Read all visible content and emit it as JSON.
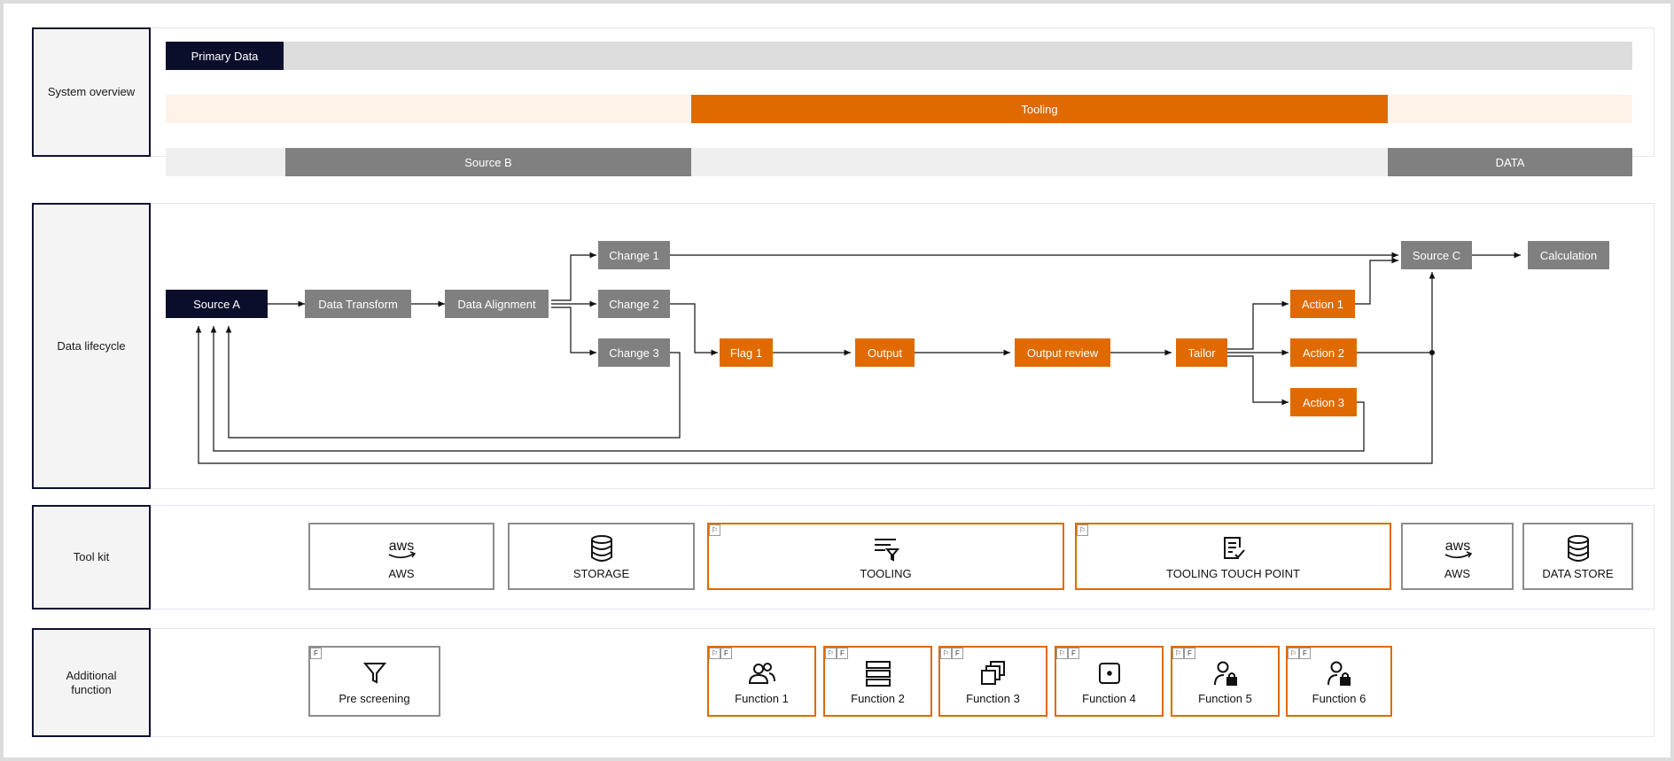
{
  "rows": {
    "system_overview": "System overview",
    "data_lifecycle": "Data lifecycle",
    "tool_kit": "Tool kit",
    "additional_function_line1": "Additional",
    "additional_function_line2": "function"
  },
  "overview": {
    "primary_data": "Primary Data",
    "tooling": "Tooling",
    "source_b": "Source B",
    "data": "DATA"
  },
  "lifecycle": {
    "source_a": "Source A",
    "data_transform": "Data Transform",
    "data_alignment": "Data Alignment",
    "change_1": "Change 1",
    "change_2": "Change 2",
    "change_3": "Change 3",
    "flag_1": "Flag 1",
    "output": "Output",
    "output_review": "Output review",
    "tailor": "Tailor",
    "action_1": "Action 1",
    "action_2": "Action 2",
    "action_3": "Action 3",
    "source_c": "Source C",
    "calculation": "Calculation"
  },
  "toolkit": {
    "aws_1": "AWS",
    "storage": "STORAGE",
    "tooling": "TOOLING",
    "tooling_touch_point": "TOOLING TOUCH POINT",
    "aws_2": "AWS",
    "data_store": "DATA STORE"
  },
  "functions": {
    "pre_screening": "Pre screening",
    "function_1": "Function 1",
    "function_2": "Function 2",
    "function_3": "Function 3",
    "function_4": "Function 4",
    "function_5": "Function 5",
    "function_6": "Function 6"
  },
  "tags": {
    "f": "F"
  },
  "colors": {
    "navy": "#0b0e2b",
    "grey": "#808080",
    "orange": "#e06a00",
    "light_grey_track": "#dcdcdc",
    "light_orange_track": "#fff2e9"
  },
  "icons": {
    "aws": "aws-logo-icon",
    "storage": "database-icon",
    "tooling": "filter-list-icon",
    "touch_point": "document-check-icon",
    "pre_screening": "funnel-icon",
    "function_1": "users-icon",
    "function_2": "server-stack-icon",
    "function_3": "copy-stack-icon",
    "function_4": "dice-icon",
    "function_5": "user-lock-icon",
    "function_6": "user-lock-icon",
    "tag": "flag-icon"
  }
}
